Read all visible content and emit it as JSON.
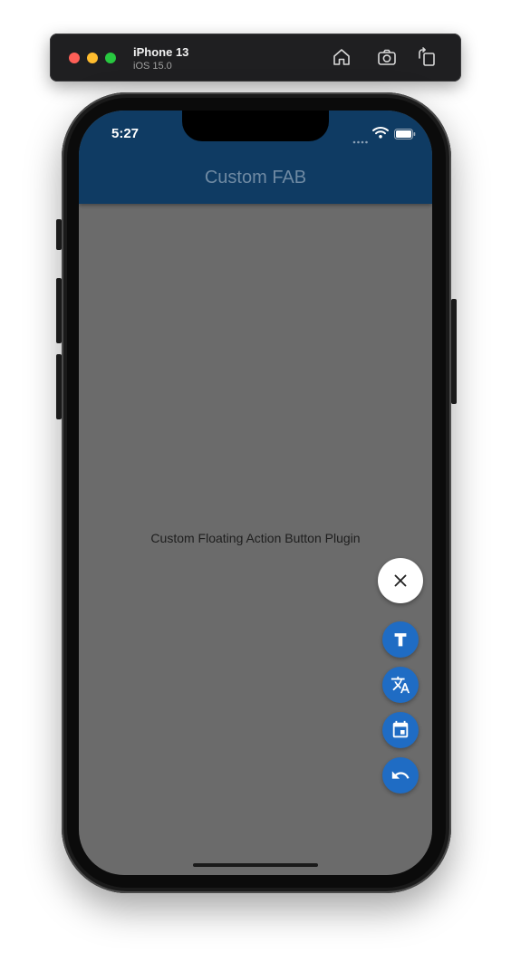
{
  "simulator": {
    "device_name": "iPhone 13",
    "os_version": "iOS 15.0",
    "toolbar_icons": [
      "home-icon",
      "screenshot-icon",
      "rotate-icon"
    ]
  },
  "status_bar": {
    "time": "5:27",
    "icons": [
      "cellular-signal-icon",
      "wifi-icon",
      "battery-icon"
    ]
  },
  "app": {
    "title": "Custom FAB",
    "body_text": "Custom Floating Action Button Plugin",
    "colors": {
      "appbar": "#0f3b63",
      "background_overlay": "#6b6b6b",
      "fab_accent": "#1f6cc4",
      "fab_main": "#ffffff"
    }
  },
  "fab": {
    "main_icon": "close-icon",
    "actions": [
      {
        "icon": "text-format-icon"
      },
      {
        "icon": "translate-icon"
      },
      {
        "icon": "calendar-icon"
      },
      {
        "icon": "undo-icon"
      }
    ]
  }
}
